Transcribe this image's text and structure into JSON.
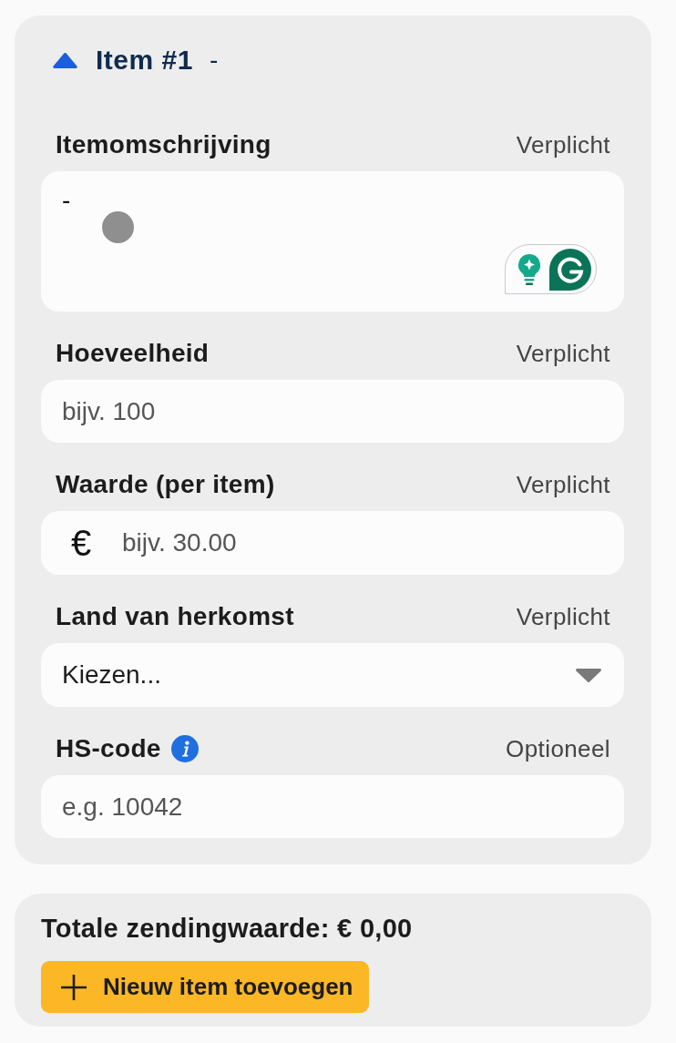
{
  "item": {
    "title": "Item #1",
    "subtitle": "-",
    "expanded": true
  },
  "fields": [
    {
      "kind": "textarea",
      "label": "Itemomschrijving",
      "requirement": "Verplicht",
      "value": "-"
    },
    {
      "kind": "text",
      "label": "Hoeveelheid",
      "requirement": "Verplicht",
      "placeholder": "bijv. 100"
    },
    {
      "kind": "currency",
      "label": "Waarde (per item)",
      "requirement": "Verplicht",
      "prefix": "€",
      "placeholder": "bijv. 30.00"
    },
    {
      "kind": "select",
      "label": "Land van herkomst",
      "requirement": "Verplicht",
      "value": "Kiezen..."
    },
    {
      "kind": "text",
      "label": "HS-code",
      "info": true,
      "requirement": "Optioneel",
      "placeholder": "e.g. 10042"
    }
  ],
  "summary": {
    "total": "Totale zendingwaarde: € 0,00",
    "add_button": "Nieuw item toevoegen"
  }
}
